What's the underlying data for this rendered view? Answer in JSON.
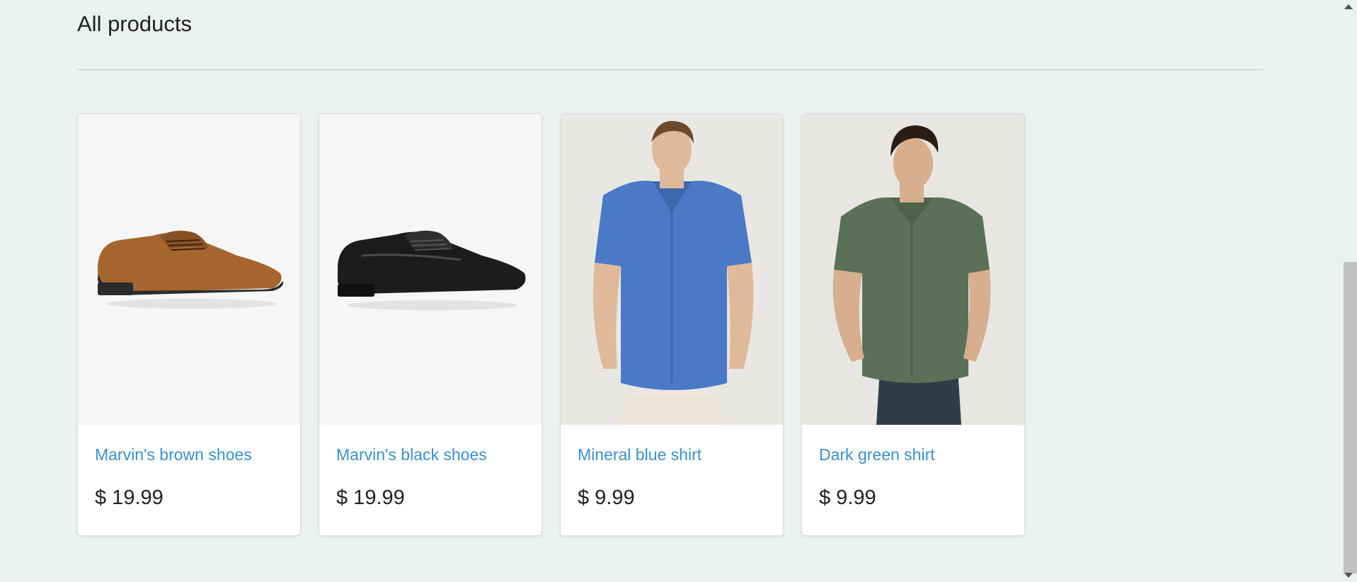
{
  "page": {
    "title": "All products"
  },
  "products": [
    {
      "name": "Marvin's brown shoes",
      "price": "$ 19.99",
      "image": "brown-shoe-image",
      "color": "#a5652e"
    },
    {
      "name": "Marvin's black shoes",
      "price": "$ 19.99",
      "image": "black-shoe-image",
      "color": "#1c1c1c"
    },
    {
      "name": "Mineral blue shirt",
      "price": "$ 9.99",
      "image": "blue-shirt-image",
      "color": "#4a7ac6"
    },
    {
      "name": "Dark green shirt",
      "price": "$ 9.99",
      "image": "green-shirt-image",
      "color": "#5a7157"
    }
  ],
  "colors": {
    "background": "#ecf0f1",
    "link": "#3a8fd1",
    "text": "#222222"
  }
}
